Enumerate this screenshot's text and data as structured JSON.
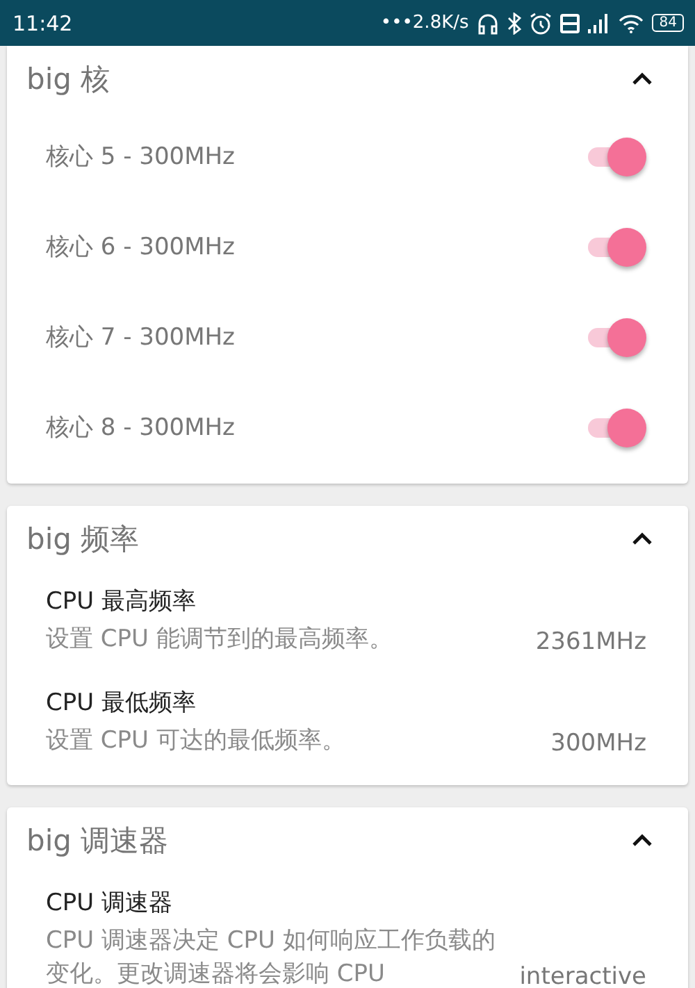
{
  "status_bar": {
    "time": "11:42",
    "net_speed": "•••2.8K/s",
    "battery": "84"
  },
  "cards": [
    {
      "title": "big 核",
      "expanded": true,
      "kind": "switches",
      "items": [
        {
          "label": "核心 5 - 300MHz",
          "on": true
        },
        {
          "label": "核心 6 - 300MHz",
          "on": true
        },
        {
          "label": "核心 7 - 300MHz",
          "on": true
        },
        {
          "label": "核心 8 - 300MHz",
          "on": true
        }
      ]
    },
    {
      "title": "big 频率",
      "expanded": true,
      "kind": "values",
      "items": [
        {
          "title": "CPU 最高频率",
          "description": "设置 CPU 能调节到的最高频率。",
          "value": "2361MHz"
        },
        {
          "title": "CPU 最低频率",
          "description": "设置 CPU 可达的最低频率。",
          "value": "300MHz"
        }
      ]
    },
    {
      "title": "big 调速器",
      "expanded": true,
      "kind": "values",
      "items": [
        {
          "title": "CPU 调速器",
          "description": "CPU 调速器决定 CPU 如何响应工作负载的变化。更改调速器将会影响 CPU",
          "value": "interactive"
        }
      ]
    }
  ]
}
